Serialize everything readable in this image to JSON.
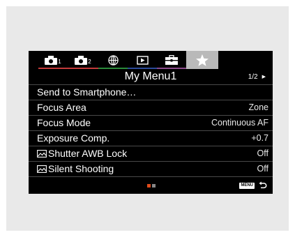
{
  "tabs": [
    {
      "icon": "camera-icon",
      "sub": "1"
    },
    {
      "icon": "camera-icon",
      "sub": "2"
    },
    {
      "icon": "globe-icon"
    },
    {
      "icon": "playback-icon"
    },
    {
      "icon": "toolbox-icon"
    },
    {
      "icon": "star-icon",
      "active": true
    }
  ],
  "header": {
    "title": "My Menu1",
    "page": "1/2"
  },
  "menu": [
    {
      "label": "Send to Smartphone…",
      "value": ""
    },
    {
      "label": "Focus Area",
      "value": "Zone"
    },
    {
      "label": "Focus Mode",
      "value": "Continuous AF"
    },
    {
      "label": "Exposure Comp.",
      "value": "+0.7"
    },
    {
      "label": "Shutter AWB Lock",
      "value": "Off",
      "icon": "photo-icon"
    },
    {
      "label": "Silent Shooting",
      "value": "Off",
      "icon": "photo-icon"
    }
  ],
  "footer": {
    "menu_button": "MENU",
    "page_dots": [
      true,
      false
    ]
  },
  "colors": {
    "active_tab_bg": "#b9b9b9",
    "page_dot_active": "#e04a1a"
  }
}
